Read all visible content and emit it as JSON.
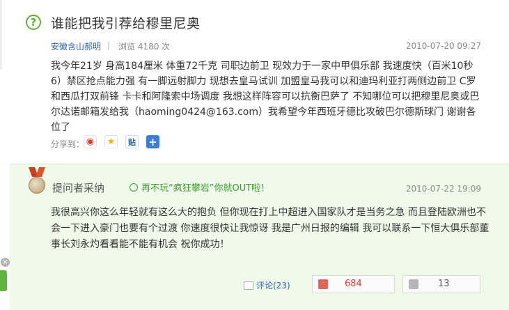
{
  "question": {
    "icon": "question-icon",
    "title": "谁能把我引荐给穆里尼奥",
    "asker": "安徽含山郝明",
    "separator": "|",
    "views": "浏览 4180 次",
    "time": "2010-07-20 09:27",
    "body": "我今年21岁 身高184厘米 体重72千克 司职边前卫 现效力于一家中甲俱乐部 我速度快（百米10秒6）禁区抢点能力强 有一脚远射脚力 现想去皇马试训 加盟皇马我可以和迪玛利亚打两侧边前卫 C罗和西瓜打双前锋 卡卡和阿隆索中场调度 我想这样阵容可以抗衡巴萨了 不知哪位可以把穆里尼奥或巴尔达诺邮箱发给我（haoming0424@163.com）我希望今年西班牙德比攻破巴尔德斯球门 谢谢各位了",
    "share_label": "分享到：",
    "share_icons": [
      "weibo-icon",
      "qzone-icon",
      "tieba-icon",
      "more-share-icon"
    ]
  },
  "answer": {
    "medal_icon": "medal-icon",
    "adopted_label": "提问者采纳",
    "ad_text": "再不玩“疯狂攀岩”你就OUT啦！",
    "time": "2010-07-22 19:09",
    "body": "我很高兴你这么年轻就有这么大的抱负 但你现在打上中超进入国家队才是当务之急 而且登陆欧洲也不会一下进入豪门也要有个过渡  你速度很快让我惊讶 我是广州日报的编辑 我可以联系一下恒大俱乐部董事长刘永灼看看能不能有机会  祝你成功！",
    "comment_label": "评论(23)",
    "upvotes": "684",
    "downvotes": "13"
  },
  "side": {
    "close": "×"
  },
  "colors": {
    "accent_green": "#5fb236",
    "link_blue": "#2d64b3",
    "adopted_bg": "#f0faea",
    "upvote_red": "#e23c2a"
  }
}
